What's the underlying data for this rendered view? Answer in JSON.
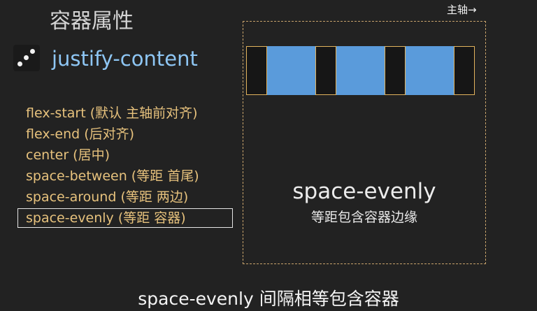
{
  "section_title": "容器属性",
  "property": {
    "name": "justify-content",
    "icon": "dice-icon"
  },
  "values": [
    {
      "label": "flex-start (默认 主轴前对齐)",
      "selected": false
    },
    {
      "label": "flex-end (后对齐)",
      "selected": false
    },
    {
      "label": "center (居中)",
      "selected": false
    },
    {
      "label": "space-between (等距 首尾)",
      "selected": false
    },
    {
      "label": "space-around (等距 两边)",
      "selected": false
    },
    {
      "label": "space-evenly (等距 容器)",
      "selected": true
    }
  ],
  "demo": {
    "axis_label": "主轴→",
    "title": "space-evenly",
    "subtitle": "等距包含容器边缘",
    "item_count": 3
  },
  "caption": "space-evenly 间隔相等包含容器",
  "colors": {
    "background": "#222222",
    "property_name": "#8ec6f4",
    "value_text": "#e7c27d",
    "block_fill": "#5a9bdb",
    "gap_outline": "#e2b35d",
    "container_border": "#c8a36b"
  }
}
